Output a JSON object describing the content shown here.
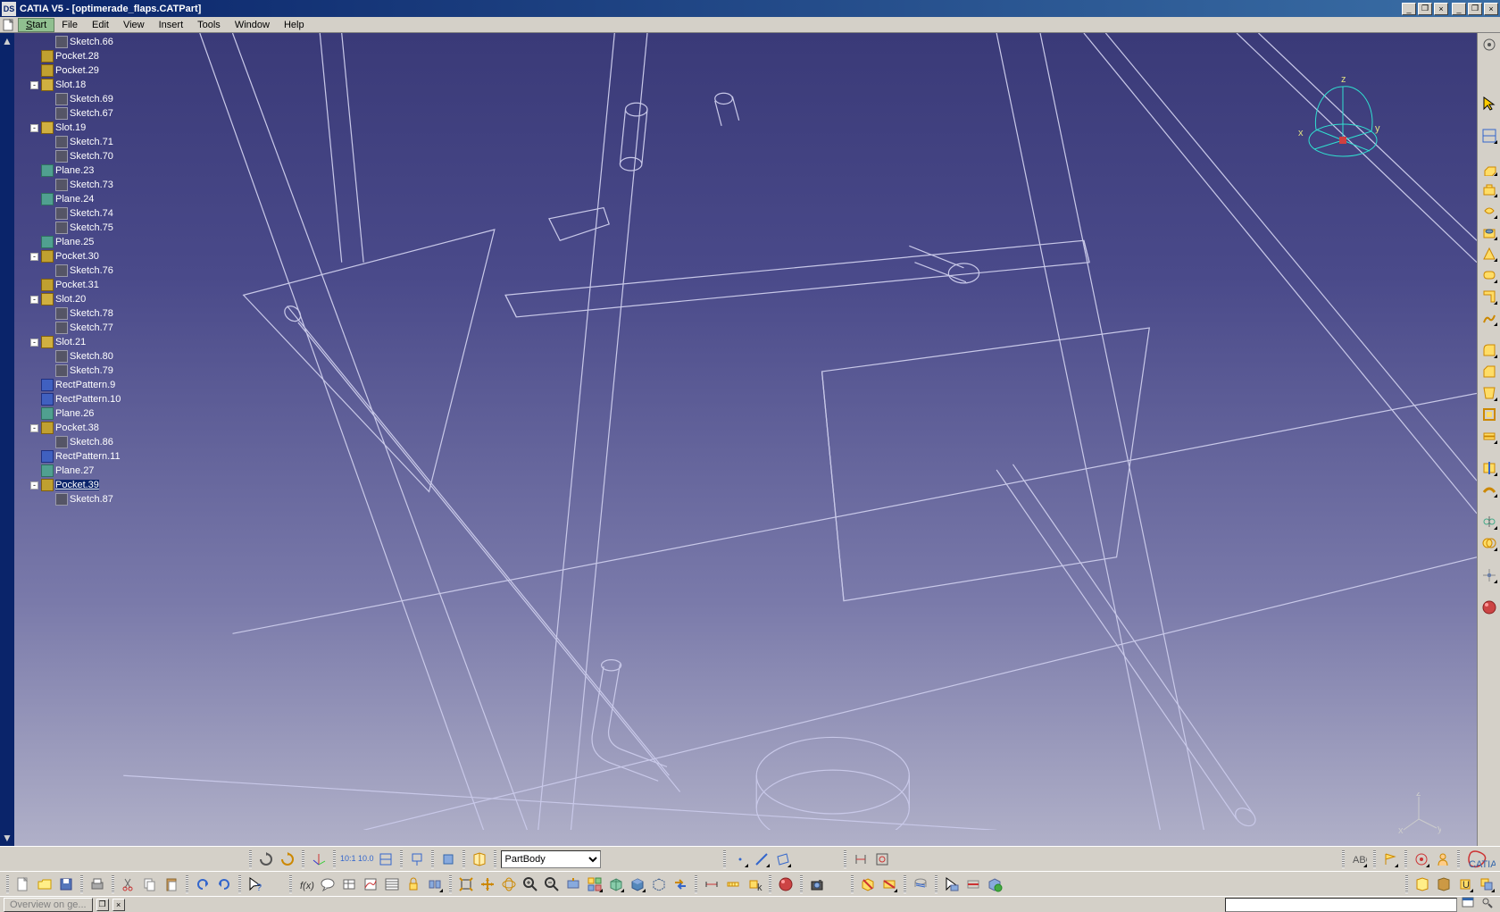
{
  "title": "CATIA V5 - [optimerade_flaps.CATPart]",
  "menu": {
    "start": "Start",
    "file": "File",
    "edit": "Edit",
    "view": "View",
    "insert": "Insert",
    "tools": "Tools",
    "window": "Window",
    "help": "Help"
  },
  "tree": [
    {
      "indent": 2,
      "toggle": "",
      "icon": "sketch",
      "label": "Sketch.66"
    },
    {
      "indent": 1,
      "toggle": "",
      "icon": "pocket",
      "label": "Pocket.28"
    },
    {
      "indent": 1,
      "toggle": "",
      "icon": "pocket",
      "label": "Pocket.29"
    },
    {
      "indent": 1,
      "toggle": "-",
      "icon": "slot",
      "label": "Slot.18"
    },
    {
      "indent": 2,
      "toggle": "",
      "icon": "sketch",
      "label": "Sketch.69"
    },
    {
      "indent": 2,
      "toggle": "",
      "icon": "sketch",
      "label": "Sketch.67"
    },
    {
      "indent": 1,
      "toggle": "-",
      "icon": "slot",
      "label": "Slot.19"
    },
    {
      "indent": 2,
      "toggle": "",
      "icon": "sketch",
      "label": "Sketch.71"
    },
    {
      "indent": 2,
      "toggle": "",
      "icon": "sketch",
      "label": "Sketch.70"
    },
    {
      "indent": 1,
      "toggle": "",
      "icon": "plane",
      "label": "Plane.23"
    },
    {
      "indent": 2,
      "toggle": "",
      "icon": "sketch",
      "label": "Sketch.73"
    },
    {
      "indent": 1,
      "toggle": "",
      "icon": "plane",
      "label": "Plane.24"
    },
    {
      "indent": 2,
      "toggle": "",
      "icon": "sketch",
      "label": "Sketch.74"
    },
    {
      "indent": 2,
      "toggle": "",
      "icon": "sketch",
      "label": "Sketch.75"
    },
    {
      "indent": 1,
      "toggle": "",
      "icon": "plane",
      "label": "Plane.25"
    },
    {
      "indent": 1,
      "toggle": "-",
      "icon": "pocket",
      "label": "Pocket.30"
    },
    {
      "indent": 2,
      "toggle": "",
      "icon": "sketch",
      "label": "Sketch.76"
    },
    {
      "indent": 1,
      "toggle": "",
      "icon": "pocket",
      "label": "Pocket.31"
    },
    {
      "indent": 1,
      "toggle": "-",
      "icon": "slot",
      "label": "Slot.20"
    },
    {
      "indent": 2,
      "toggle": "",
      "icon": "sketch",
      "label": "Sketch.78"
    },
    {
      "indent": 2,
      "toggle": "",
      "icon": "sketch",
      "label": "Sketch.77"
    },
    {
      "indent": 1,
      "toggle": "-",
      "icon": "slot",
      "label": "Slot.21"
    },
    {
      "indent": 2,
      "toggle": "",
      "icon": "sketch",
      "label": "Sketch.80"
    },
    {
      "indent": 2,
      "toggle": "",
      "icon": "sketch",
      "label": "Sketch.79"
    },
    {
      "indent": 1,
      "toggle": "",
      "icon": "pattern",
      "label": "RectPattern.9"
    },
    {
      "indent": 1,
      "toggle": "",
      "icon": "pattern",
      "label": "RectPattern.10"
    },
    {
      "indent": 1,
      "toggle": "",
      "icon": "plane",
      "label": "Plane.26"
    },
    {
      "indent": 1,
      "toggle": "-",
      "icon": "pocket",
      "label": "Pocket.38"
    },
    {
      "indent": 2,
      "toggle": "",
      "icon": "sketch",
      "label": "Sketch.86"
    },
    {
      "indent": 1,
      "toggle": "",
      "icon": "pattern",
      "label": "RectPattern.11"
    },
    {
      "indent": 1,
      "toggle": "",
      "icon": "plane",
      "label": "Plane.27"
    },
    {
      "indent": 1,
      "toggle": "-",
      "icon": "pocket",
      "label": "Pocket.39",
      "active": true
    },
    {
      "indent": 2,
      "toggle": "",
      "icon": "sketch",
      "label": "Sketch.87"
    }
  ],
  "body_select": "PartBody",
  "compass": {
    "x": "x",
    "y": "y",
    "z": "z"
  },
  "status": {
    "overview": "Overview on ge..."
  },
  "dim_label": "10:1\n10.0",
  "logo": "CATIA"
}
